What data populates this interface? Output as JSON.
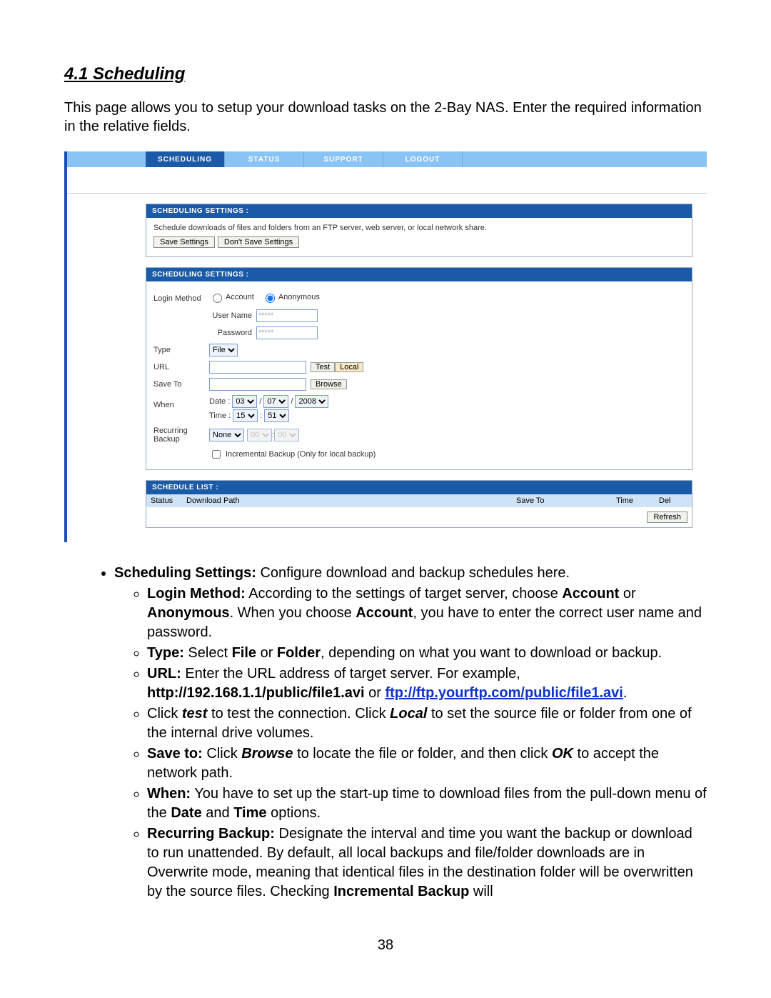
{
  "heading": "4.1 Scheduling",
  "intro": "This page allows you to setup your download tasks on the 2-Bay NAS. Enter the required information in the relative fields.",
  "nav": {
    "scheduling": "Scheduling",
    "status": "Status",
    "support": "Support",
    "logout": "Logout"
  },
  "panel1": {
    "title": "Scheduling Settings :",
    "desc": "Schedule downloads of files and folders from an FTP server, web server, or local network share.",
    "save": "Save Settings",
    "dont": "Don't Save Settings"
  },
  "panel2": {
    "title": "Scheduling Settings :",
    "login_method_label": "Login Method",
    "account": "Account",
    "anonymous": "Anonymous",
    "username_label": "User Name",
    "username_val": "*****",
    "password_label": "Password",
    "password_val": "*****",
    "type_label": "Type",
    "type_val": "File",
    "url_label": "URL",
    "test": "Test",
    "local": "Local",
    "saveto_label": "Save To",
    "browse": "Browse",
    "when_label": "When",
    "date_label": "Date :",
    "time_label": "Time :",
    "d_month": "03",
    "d_day": "07",
    "d_year": "2008",
    "t_hour": "15",
    "t_min": "51",
    "recurring_label": "Recurring Backup",
    "recurring_val": "None",
    "rec_h": "00",
    "rec_m": "00",
    "incremental": "Incremental Backup (Only for local backup)"
  },
  "panel3": {
    "title": "Schedule List :",
    "status": "Status",
    "dlpath": "Download Path",
    "saveto": "Save To",
    "time": "Time",
    "del": "Del",
    "refresh": "Refresh"
  },
  "explain": {
    "li1_b": "Scheduling Settings:",
    "li1_t": " Configure download and backup schedules here.",
    "s1_b": "Login Method:",
    "s1_t1": " According to the settings of target server, choose ",
    "s1_acc": "Account",
    "s1_or": " or ",
    "s1_anon": "Anonymous",
    "s1_t2": ". When you choose ",
    "s1_acc2": "Account",
    "s1_t3": ", you have to enter the correct user name and password.",
    "s2_b": "Type:",
    "s2_t1": " Select ",
    "s2_file": "File",
    "s2_or": " or ",
    "s2_folder": "Folder",
    "s2_t2": ", depending on what you want to download or backup.",
    "s3_b": "URL:",
    "s3_t1": " Enter the URL address of target server. For example, ",
    "s3_http": "http://192.168.1.1/public/file1.avi",
    "s3_or": " or ",
    "s3_ftp": "ftp://ftp.yourftp.com/public/file1.avi",
    "s3_dot": ".",
    "s4_t1": "Click ",
    "s4_test": "test",
    "s4_t2": " to test the connection. Click ",
    "s4_local": "Local",
    "s4_t3": " to set the source file or folder from one of the internal drive volumes.",
    "s5_b": "Save to:",
    "s5_t1": " Click ",
    "s5_browse": "Browse",
    "s5_t2": " to locate the file or folder, and then click ",
    "s5_ok": "OK",
    "s5_t3": " to accept the network path.",
    "s6_b": "When:",
    "s6_t1": " You have to set up the start-up time to download files from the pull-down menu of the ",
    "s6_date": "Date",
    "s6_and": " and ",
    "s6_time": "Time",
    "s6_t2": " options.",
    "s7_b": "Recurring Backup:",
    "s7_t1": " Designate the interval and time you want the backup or download to run unattended. By default, all local backups and file/folder downloads are in Overwrite mode, meaning that identical files in the destination folder will be overwritten by the source files. Checking ",
    "s7_inc": "Incremental Backup",
    "s7_t2": " will"
  },
  "page_number": "38"
}
